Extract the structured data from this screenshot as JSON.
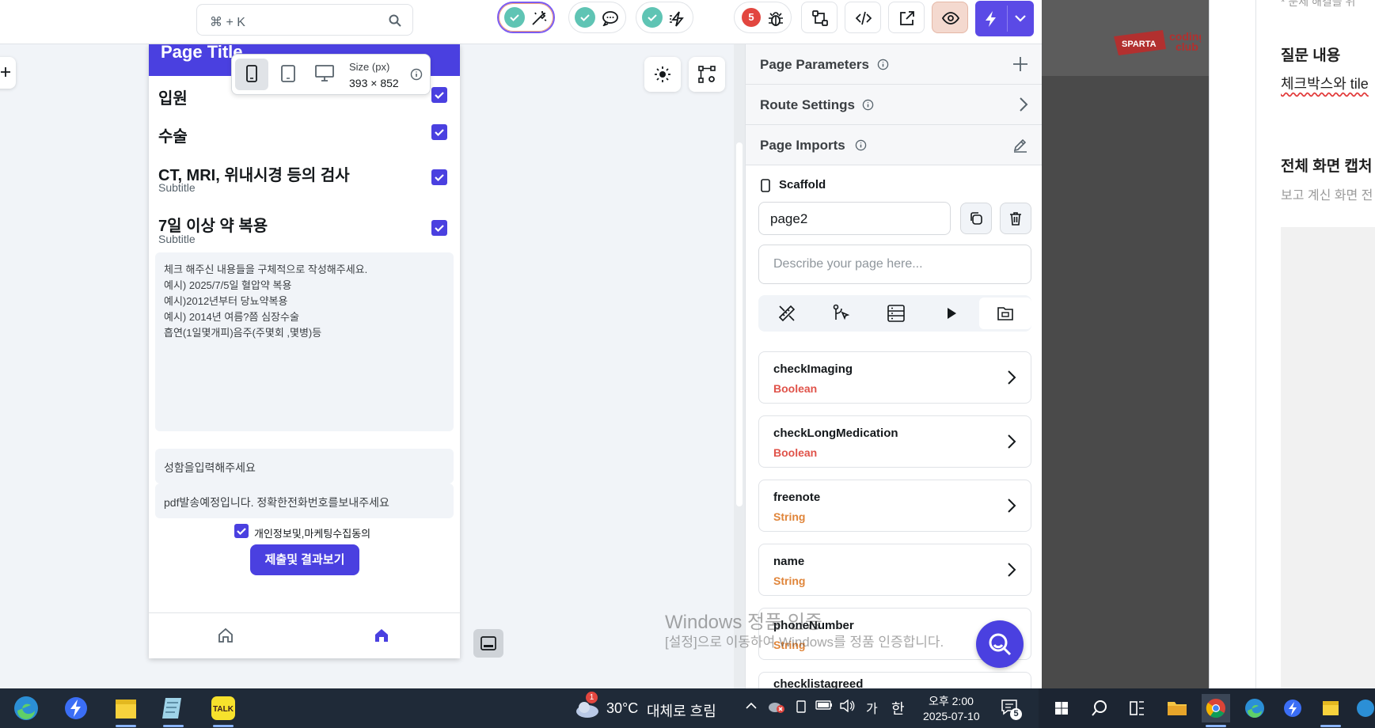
{
  "toolbar": {
    "search_shortcut": "⌘ + K",
    "bug_count": "5"
  },
  "canvas": {
    "size_label": "Size (px)",
    "size_value": "393 × 852"
  },
  "phone": {
    "page_title": "Page Title",
    "rows": [
      {
        "label": "입원",
        "subtitle": ""
      },
      {
        "label": "수술",
        "subtitle": ""
      },
      {
        "label": "CT, MRI, 위내시경 등의 검사",
        "subtitle": "Subtitle"
      },
      {
        "label": "7일 이상 약 복용",
        "subtitle": "Subtitle"
      }
    ],
    "notes": [
      "체크 해주신 내용들을 구체적으로 작성해주세요.",
      "예시) 2025/7/5일 혈압약 복용",
      "예시)2012년부터 당뇨약복용",
      "예시) 2014년 여름?쯤 심장수술",
      "흡연(1일몇개피)음주(주몇회 ,몇병)등"
    ],
    "name_placeholder": "성함을입력해주세요",
    "phone_placeholder": "pdf발송예정입니다. 정확한전화번호를보내주세요",
    "agree_label": "개인정보및,마케팅수집동의",
    "submit_label": "제출및 결과보기"
  },
  "panel": {
    "page_parameters": "Page Parameters",
    "route_settings": "Route Settings",
    "page_imports": "Page Imports",
    "widget_name": "Scaffold",
    "page_name": "page2",
    "description_placeholder": "Describe your page here...",
    "params": [
      {
        "name": "checkImaging",
        "type": "Boolean",
        "color": "#e0534a"
      },
      {
        "name": "checkLongMedication",
        "type": "Boolean",
        "color": "#e0534a"
      },
      {
        "name": "freenote",
        "type": "String",
        "color": "#e0853a"
      },
      {
        "name": "name",
        "type": "String",
        "color": "#e0853a"
      },
      {
        "name": "phoneNumber",
        "type": "String",
        "color": "#e0853a"
      },
      {
        "name": "checklistagreed",
        "type": "",
        "color": "#e0853a"
      }
    ]
  },
  "watermark": {
    "line1": "Windows 정품 인증",
    "line2": "[설정]으로 이동하여 Windows를 정품 인증합니다."
  },
  "doc": {
    "top_cut": "* 문제 해결을 위",
    "heading1": "질문 내용",
    "body1": "체크박스와 tile",
    "heading2": "전체 화면 캡처",
    "body2": "보고 계신 화면 전"
  },
  "brand": {
    "sparta": "SPARTA",
    "coding": "coding",
    "club": "club"
  },
  "taskbar": {
    "weather_temp": "30°C",
    "weather_desc": "대체로 흐림",
    "weather_alert": "1",
    "ime_1": "가",
    "ime_2": "한",
    "time": "오후 2:00",
    "date": "2025-07-10",
    "notifications": "5"
  },
  "colors": {
    "primary": "#4a40e0",
    "boolean": "#e0534a",
    "string": "#e0853a",
    "check": "#5fc4b4"
  }
}
